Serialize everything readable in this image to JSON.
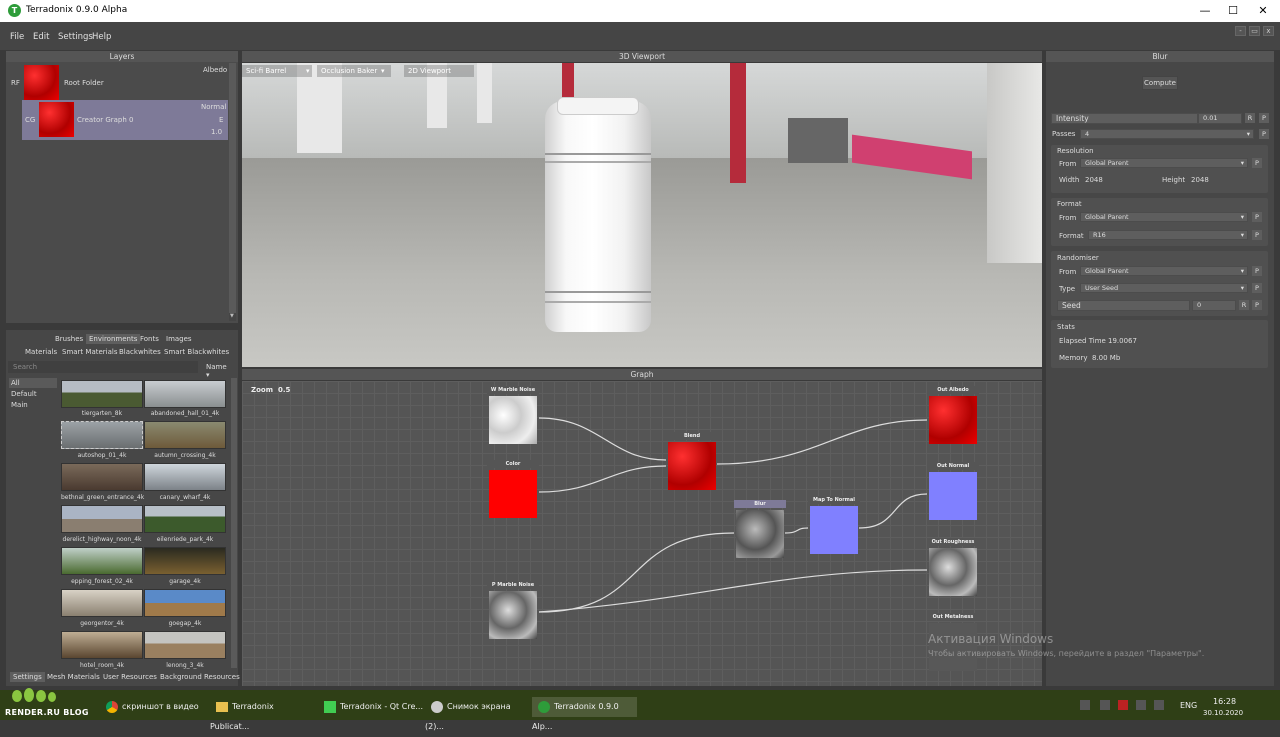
{
  "window": {
    "title": "Terradonix 0.9.0 Alpha",
    "logo_letter": "T",
    "min": "—",
    "max": "☐",
    "close": "✕"
  },
  "menu": {
    "items": [
      "File",
      "Edit",
      "Settings",
      "Help"
    ],
    "mdi": [
      "-",
      "▭",
      "x"
    ]
  },
  "layers": {
    "header": "Layers",
    "rows": [
      {
        "tag": "RF",
        "name": "Root Folder",
        "channel": "Albedo"
      },
      {
        "tag": "CG",
        "name": "Creator Graph 0",
        "channel": "Normal",
        "mode": "E",
        "opacity": "1.0"
      }
    ]
  },
  "library": {
    "tabs_row1": [
      "Brushes",
      "Environments",
      "Fonts",
      "Images"
    ],
    "tabs_row2": [
      "Materials",
      "Smart Materials",
      "Blackwhites",
      "Smart Blackwhites"
    ],
    "search_placeholder": "Search",
    "sort": "Name",
    "categories": [
      "All",
      "Default",
      "Main"
    ],
    "items": [
      "tiergarten_8k",
      "abandoned_hall_01_4k",
      "autoshop_01_4k",
      "autumn_crossing_4k",
      "bethnal_green_entrance_4k",
      "canary_wharf_4k",
      "derelict_highway_noon_4k",
      "eilenriede_park_4k",
      "epping_forest_02_4k",
      "garage_4k",
      "georgentor_4k",
      "goegap_4k",
      "hotel_room_4k",
      "lenong_3_4k"
    ],
    "bottom_tabs": [
      "Settings",
      "Mesh Materials",
      "User Resources",
      "Background Resources"
    ]
  },
  "viewport": {
    "header": "3D Viewport",
    "dropdowns": [
      "Sci-fi Barrel",
      "Occlusion Baker",
      "2D Viewport"
    ]
  },
  "graph": {
    "header": "Graph",
    "zoom_label": "Zoom",
    "zoom_value": "0.5",
    "nodes": {
      "w_marble": "W Marble Noise",
      "color": "Color",
      "blend": "Blend",
      "blur": "Blur",
      "map_normal": "Map To Normal",
      "p_marble": "P Marble Noise",
      "out_albedo": "Out Albedo",
      "out_normal": "Out Normal",
      "out_roughness": "Out Roughness",
      "out_metalness": "Out Metalness"
    },
    "colors": {
      "red": "#ff0000",
      "normal": "#8080ff"
    }
  },
  "properties": {
    "header": "Blur",
    "compute": "Compute",
    "intensity_label": "Intensity",
    "intensity_value": "0.01",
    "passes_label": "Passes",
    "passes_value": "4",
    "resolution_title": "Resolution",
    "from_label": "From",
    "from_value": "Global Parent",
    "width_label": "Width",
    "width_value": "2048",
    "height_label": "Height",
    "height_value": "2048",
    "format_title": "Format",
    "format_label": "Format",
    "format_value": "R16",
    "randomiser_title": "Randomiser",
    "type_label": "Type",
    "type_value": "User Seed",
    "seed_label": "Seed",
    "seed_value": "0",
    "stats_title": "Stats",
    "elapsed_label": "Elapsed Time",
    "elapsed_value": "19.0067",
    "memory_label": "Memory",
    "memory_value": "8.00 Mb",
    "r": "R",
    "p": "P"
  },
  "watermark": {
    "line1": "Активация Windows",
    "line2": "Чтобы активировать Windows, перейдите в раздел \"Параметры\"."
  },
  "taskbar": {
    "brand": "RENDER.RU BLOG",
    "items": [
      "скриншот в видео",
      "Terradonix Publicat...",
      "Terradonix - Qt Cre...",
      "Снимок экрана (2)...",
      "Terradonix 0.9.0 Alp..."
    ],
    "lang": "ENG",
    "time": "16:28",
    "date": "30.10.2020"
  }
}
